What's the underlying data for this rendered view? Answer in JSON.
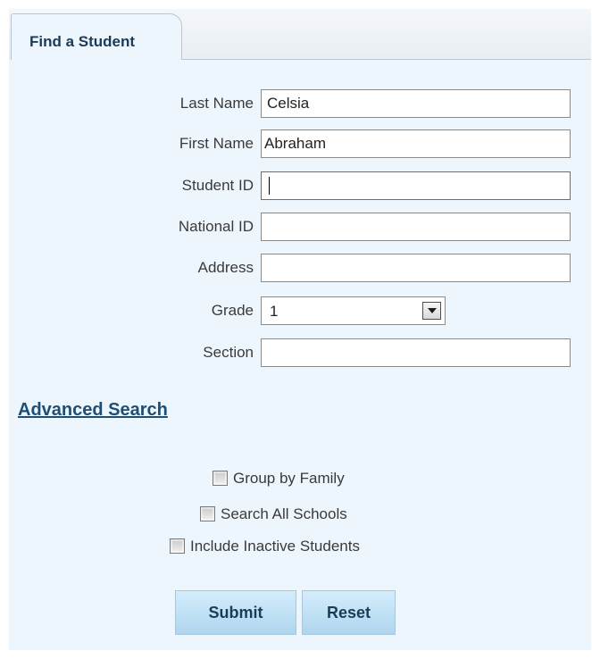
{
  "tab": {
    "label": "Find a Student"
  },
  "form": {
    "last_name": {
      "label": "Last Name",
      "value": "Celsia"
    },
    "first_name": {
      "label": "First Name",
      "value": "Abraham"
    },
    "student_id": {
      "label": "Student ID",
      "value": ""
    },
    "national_id": {
      "label": "National ID",
      "value": ""
    },
    "address": {
      "label": "Address",
      "value": ""
    },
    "grade": {
      "label": "Grade",
      "selected": "1"
    },
    "section": {
      "label": "Section",
      "value": ""
    }
  },
  "advanced_search": {
    "label": "Advanced Search"
  },
  "options": [
    {
      "label": "Group by Family",
      "checked": false
    },
    {
      "label": "Search All Schools",
      "checked": false
    },
    {
      "label": "Include Inactive Students",
      "checked": false
    }
  ],
  "buttons": {
    "submit_label": "Submit",
    "reset_label": "Reset"
  },
  "colors": {
    "panel_background": "#eef6fd",
    "tab_text": "#1c3b57",
    "link": "#1f4e74",
    "button_gradient_top": "#d5edfb",
    "button_gradient_bottom": "#aed5ee"
  },
  "icons": {
    "grade_dropdown": "chevron-down-icon"
  }
}
